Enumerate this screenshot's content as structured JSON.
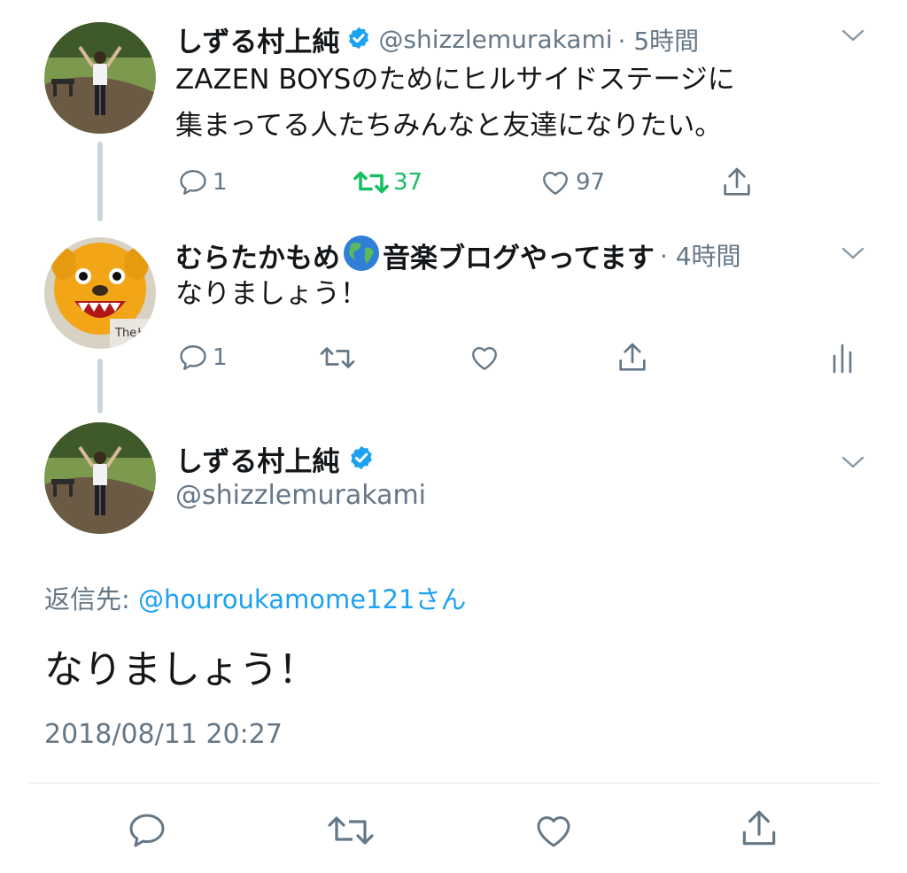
{
  "tweet1": {
    "name": "しずる村上純",
    "handle": "@shizzlemurakami",
    "time": "· 5時間",
    "text_line1": "ZAZEN BOYSのためにヒルサイドステージに",
    "text_line2": "集まってる人たちみんなと友達になりたい。",
    "reply_count": "1",
    "retweet_count": "37",
    "like_count": "97",
    "retweeted": true
  },
  "tweet2": {
    "name_before": "むらたかもめ",
    "name_after": "音楽ブログやってます",
    "time": "· 4時間",
    "text": "なりましょう！",
    "reply_count": "1",
    "avatar_caption": "Theピ"
  },
  "main_tweet": {
    "name": "しずる村上純",
    "handle": "@shizzlemurakami",
    "reply_to_label": "返信先:",
    "reply_to_user": "@houroukamome121さん",
    "text": "なりましょう！",
    "timestamp": "2018/08/11 20:27"
  },
  "colors": {
    "accent": "#1da1f2",
    "retweet_green": "#17bf63",
    "icon_gray": "#657786",
    "thread_line": "#ccd6dd"
  },
  "icons": [
    "verified-badge-icon",
    "chevron-down-icon",
    "reply-icon",
    "retweet-icon",
    "like-icon",
    "share-icon",
    "analytics-icon",
    "globe-emoji-icon"
  ]
}
